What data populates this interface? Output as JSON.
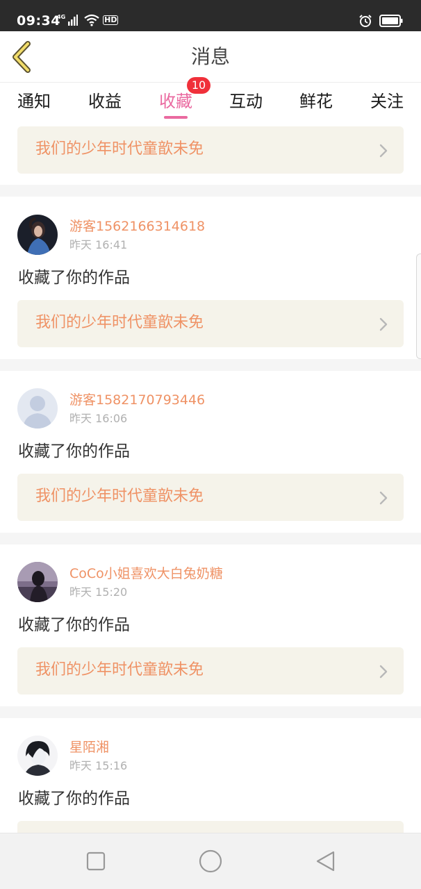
{
  "status_bar": {
    "time": "09:34",
    "network": "4G",
    "hd": "HD",
    "icons": [
      "signal-icon",
      "wifi-icon",
      "alarm-icon",
      "battery-icon"
    ]
  },
  "header": {
    "title": "消息",
    "back_icon": "chevron-left-icon"
  },
  "tabs": [
    {
      "label": "通知"
    },
    {
      "label": "收益"
    },
    {
      "label": "收藏",
      "active": true,
      "badge": "10"
    },
    {
      "label": "互动"
    },
    {
      "label": "鲜花"
    },
    {
      "label": "关注"
    }
  ],
  "colors": {
    "accent_pink": "#ea6aa0",
    "badge_red": "#f0303a",
    "name_orange": "#ef9265",
    "card_bg": "#f5f3ea"
  },
  "feed": {
    "top_card_title": "我们的少年时代童歆未免",
    "items": [
      {
        "username": "游客1562166314618",
        "time": "昨天 16:41",
        "action": "收藏了你的作品",
        "work_title": "我们的少年时代童歆未免"
      },
      {
        "username": "游客1582170793446",
        "time": "昨天 16:06",
        "action": "收藏了你的作品",
        "work_title": "我们的少年时代童歆未免"
      },
      {
        "username": "CoCo小姐喜欢大白兔奶糖",
        "time": "昨天 15:20",
        "action": "收藏了你的作品",
        "work_title": "我们的少年时代童歆未免"
      },
      {
        "username": "星陌湘",
        "time": "昨天 15:16",
        "action": "收藏了你的作品",
        "work_title": ""
      }
    ]
  },
  "nav_bar": {
    "icons": [
      "square-icon",
      "circle-icon",
      "triangle-back-icon"
    ]
  }
}
